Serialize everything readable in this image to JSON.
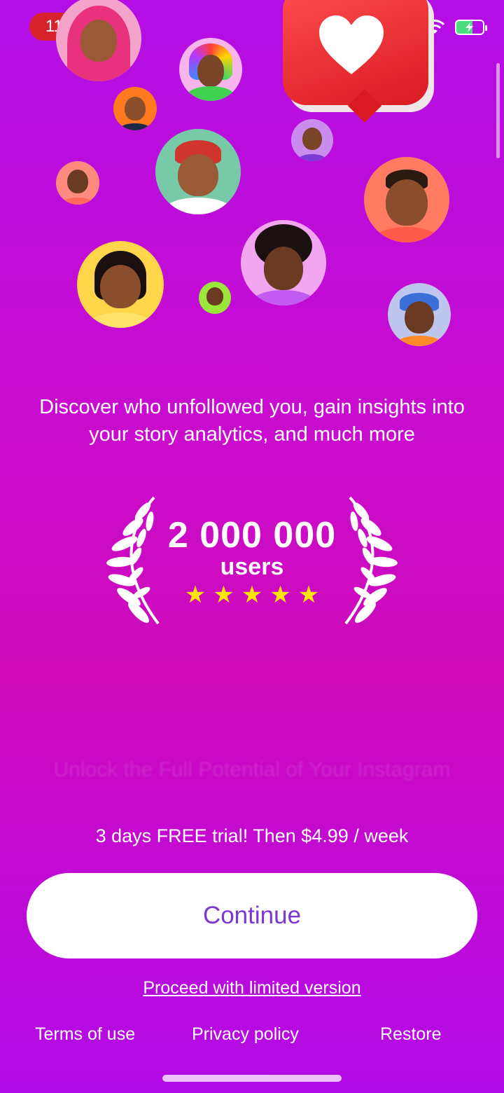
{
  "status_bar": {
    "time": "11:03",
    "icons": [
      "wifi-icon",
      "battery-charging-icon"
    ]
  },
  "hero": {
    "avatars": [
      "avatar-pink-hijab",
      "avatar-rainbow-hair",
      "avatar-orange",
      "avatar-red-beanie",
      "avatar-small-purple",
      "avatar-small-red",
      "avatar-glasses-beard",
      "avatar-afro-glasses",
      "avatar-yellow-girl",
      "avatar-tiny-green",
      "avatar-cap"
    ],
    "like_icon": "heart-icon"
  },
  "tagline": "Discover who unfollowed you, gain insights into your story analytics, and much more",
  "award": {
    "count": "2 000 000",
    "unit": "users",
    "rating": 5,
    "star_color": "#ffe600"
  },
  "faded_headline": "Unlock the Full Potential of Your Instagram",
  "trial_text": "3 days FREE trial! Then $4.99 / week",
  "continue_label": "Continue",
  "limited_label": "Proceed with limited version",
  "footer": {
    "terms": "Terms of use",
    "privacy": "Privacy policy",
    "restore": "Restore"
  },
  "colors": {
    "accent": "#7a37d4",
    "background_top": "#b30ee6",
    "background_mid": "#d00ab8",
    "time_pill": "#d6222c"
  }
}
